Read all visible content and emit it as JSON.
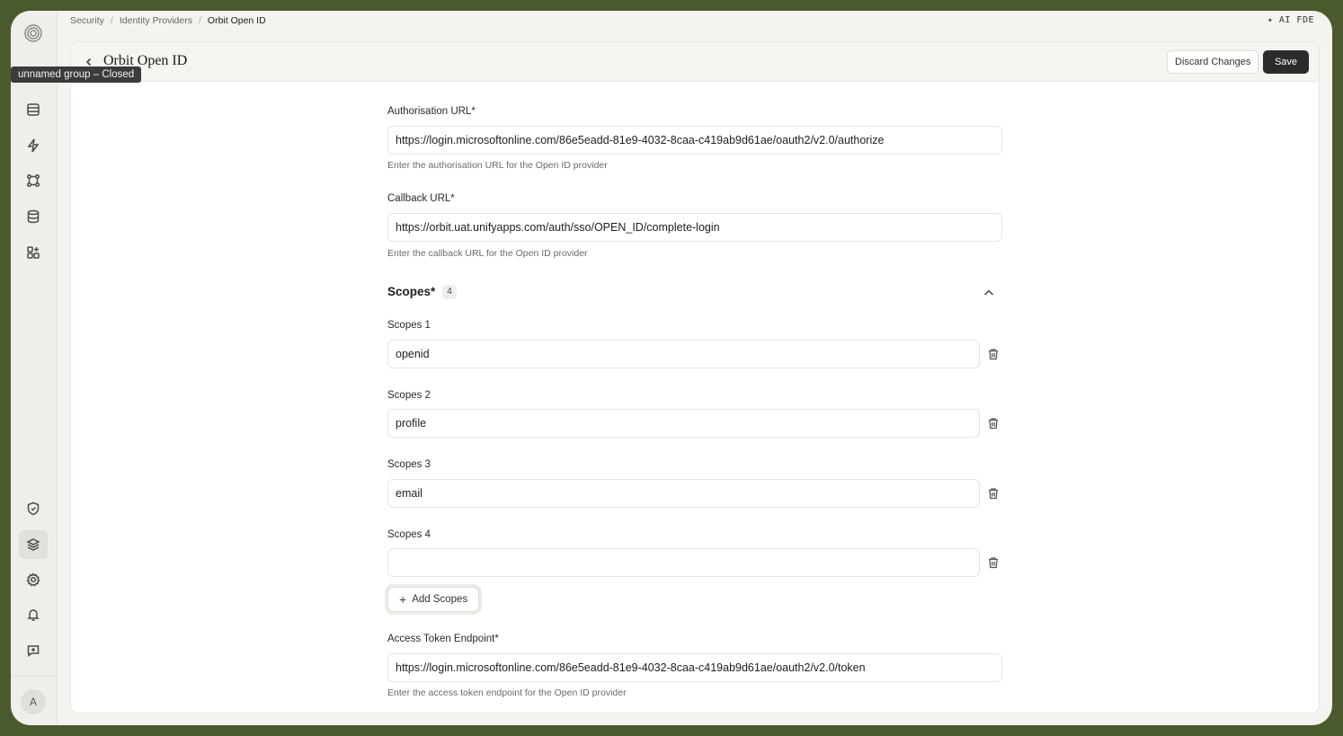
{
  "breadcrumb": [
    "Security",
    "Identity Providers",
    "Orbit Open ID"
  ],
  "topbar": {
    "ai_label": "✦ AI FDE"
  },
  "sidebar": {
    "tooltip": "unnamed group – Closed",
    "avatar": "A"
  },
  "header": {
    "title": "Orbit Open ID",
    "discard_label": "Discard Changes",
    "save_label": "Save"
  },
  "form": {
    "auth_url": {
      "label": "Authorisation URL*",
      "value": "https://login.microsoftonline.com/86e5eadd-81e9-4032-8caa-c419ab9d61ae/oauth2/v2.0/authorize",
      "help": "Enter the authorisation URL for the Open ID provider"
    },
    "callback_url": {
      "label": "Callback URL*",
      "value": "https://orbit.uat.unifyapps.com/auth/sso/OPEN_ID/complete-login",
      "help": "Enter the callback URL for the Open ID provider"
    },
    "scopes": {
      "title": "Scopes*",
      "count": "4",
      "items": [
        {
          "label": "Scopes 1",
          "value": "openid"
        },
        {
          "label": "Scopes 2",
          "value": "profile"
        },
        {
          "label": "Scopes 3",
          "value": "email"
        },
        {
          "label": "Scopes 4",
          "value": ""
        }
      ],
      "add_label": "Add Scopes"
    },
    "token_endpoint": {
      "label": "Access Token Endpoint*",
      "value": "https://login.microsoftonline.com/86e5eadd-81e9-4032-8caa-c419ab9d61ae/oauth2/v2.0/token",
      "help": "Enter the access token endpoint for the Open ID provider"
    }
  }
}
